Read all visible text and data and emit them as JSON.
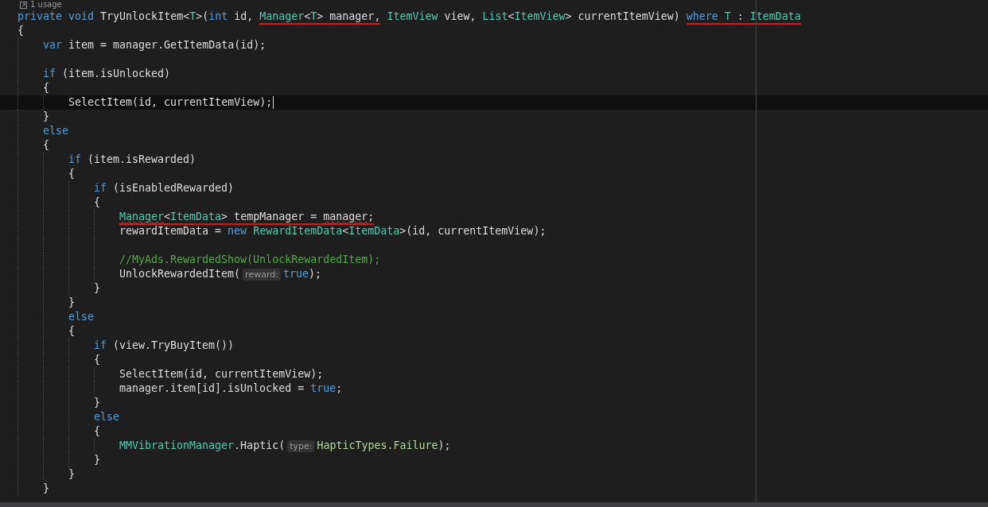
{
  "codelens": {
    "text": "1 usage"
  },
  "lines": [
    {
      "kind": "line",
      "current": false,
      "tokens": [
        {
          "kind": "keyword",
          "text": "private void "
        },
        {
          "kind": "plain",
          "text": "TryUnlockItem<"
        },
        {
          "kind": "type",
          "text": "T"
        },
        {
          "kind": "plain",
          "text": ">("
        },
        {
          "kind": "keyword",
          "text": "int"
        },
        {
          "kind": "plain",
          "text": " id, "
        },
        {
          "kind": "type",
          "text": "Manager",
          "underlined": true
        },
        {
          "kind": "plain",
          "text": "<",
          "underlined": true
        },
        {
          "kind": "type",
          "text": "T",
          "underlined": true
        },
        {
          "kind": "plain",
          "text": "> manager,",
          "underlined": true
        },
        {
          "kind": "type",
          "text": " ItemView"
        },
        {
          "kind": "plain",
          "text": " view, "
        },
        {
          "kind": "type",
          "text": "List"
        },
        {
          "kind": "plain",
          "text": "<"
        },
        {
          "kind": "type",
          "text": "ItemView"
        },
        {
          "kind": "plain",
          "text": "> currentItemView) "
        },
        {
          "kind": "keyword",
          "text": "where ",
          "underlined": true
        },
        {
          "kind": "type",
          "text": "T",
          "underlined": true
        },
        {
          "kind": "plain",
          "text": " : ",
          "underlined": true
        },
        {
          "kind": "type",
          "text": "ItemData",
          "underlined": true
        }
      ]
    },
    {
      "kind": "line",
      "current": false,
      "tokens": [
        {
          "kind": "plain",
          "text": "{"
        }
      ]
    },
    {
      "kind": "block",
      "children": [
        {
          "kind": "line",
          "current": false,
          "tokens": [
            {
              "kind": "keyword",
              "text": "var"
            },
            {
              "kind": "plain",
              "text": " item = manager.GetItemData(id);"
            }
          ]
        },
        {
          "kind": "line",
          "current": false
        },
        {
          "kind": "line",
          "current": false,
          "tokens": [
            {
              "kind": "keyword",
              "text": "if"
            },
            {
              "kind": "plain",
              "text": " (item.isUnlocked)"
            }
          ]
        },
        {
          "kind": "line",
          "current": false,
          "tokens": [
            {
              "kind": "plain",
              "text": "{"
            }
          ]
        },
        {
          "kind": "block",
          "children": [
            {
              "kind": "line",
              "current": true,
              "tokens": [
                {
                  "kind": "plain",
                  "text": "SelectItem(id, currentItemView);"
                }
              ]
            }
          ]
        },
        {
          "kind": "line",
          "current": false,
          "tokens": [
            {
              "kind": "plain",
              "text": "}"
            }
          ]
        },
        {
          "kind": "line",
          "current": false,
          "tokens": [
            {
              "kind": "keyword",
              "text": "else"
            }
          ]
        },
        {
          "kind": "line",
          "current": false,
          "tokens": [
            {
              "kind": "plain",
              "text": "{"
            }
          ]
        },
        {
          "kind": "block",
          "children": [
            {
              "kind": "line",
              "current": false,
              "tokens": [
                {
                  "kind": "keyword",
                  "text": "if"
                },
                {
                  "kind": "plain",
                  "text": " (item.isRewarded)"
                }
              ]
            },
            {
              "kind": "line",
              "current": false,
              "tokens": [
                {
                  "kind": "plain",
                  "text": "{"
                }
              ]
            },
            {
              "kind": "block",
              "children": [
                {
                  "kind": "line",
                  "current": false,
                  "tokens": [
                    {
                      "kind": "keyword",
                      "text": "if"
                    },
                    {
                      "kind": "plain",
                      "text": " (isEnabledRewarded)"
                    }
                  ]
                },
                {
                  "kind": "line",
                  "current": false,
                  "tokens": [
                    {
                      "kind": "plain",
                      "text": "{"
                    }
                  ]
                },
                {
                  "kind": "block",
                  "children": [
                    {
                      "kind": "line",
                      "current": false,
                      "tokens": [
                        {
                          "kind": "type",
                          "text": "Manager",
                          "underlined": true,
                          "squiggle": true
                        },
                        {
                          "kind": "plain",
                          "text": "<",
                          "underlined": true
                        },
                        {
                          "kind": "type",
                          "text": "ItemData",
                          "underlined": true
                        },
                        {
                          "kind": "plain",
                          "text": "> tempManager = ",
                          "underlined": true
                        },
                        {
                          "kind": "plain",
                          "text": "manager",
                          "underlined": true,
                          "squiggle": true
                        },
                        {
                          "kind": "plain",
                          "text": ";",
                          "underlined": true
                        }
                      ]
                    },
                    {
                      "kind": "line",
                      "current": false,
                      "tokens": [
                        {
                          "kind": "plain",
                          "text": "rewardItemData = "
                        },
                        {
                          "kind": "keyword",
                          "text": "new "
                        },
                        {
                          "kind": "type",
                          "text": "RewardItemData"
                        },
                        {
                          "kind": "plain",
                          "text": "<"
                        },
                        {
                          "kind": "type",
                          "text": "ItemData"
                        },
                        {
                          "kind": "plain",
                          "text": ">(id, currentItemView);"
                        }
                      ]
                    },
                    {
                      "kind": "line",
                      "current": false
                    },
                    {
                      "kind": "line",
                      "current": false,
                      "tokens": [
                        {
                          "kind": "comment",
                          "text": "//MyAds.RewardedShow(UnlockRewardedItem);"
                        }
                      ]
                    },
                    {
                      "kind": "line",
                      "current": false,
                      "tokens": [
                        {
                          "kind": "plain",
                          "text": "UnlockRewardedItem("
                        },
                        {
                          "kind": "hint",
                          "text": "reward:"
                        },
                        {
                          "kind": "keyword",
                          "text": "true"
                        },
                        {
                          "kind": "plain",
                          "text": ");"
                        }
                      ]
                    }
                  ]
                },
                {
                  "kind": "line",
                  "current": false,
                  "tokens": [
                    {
                      "kind": "plain",
                      "text": "}"
                    }
                  ]
                }
              ]
            },
            {
              "kind": "line",
              "current": false,
              "tokens": [
                {
                  "kind": "plain",
                  "text": "}"
                }
              ]
            },
            {
              "kind": "line",
              "current": false,
              "tokens": [
                {
                  "kind": "keyword",
                  "text": "else"
                }
              ]
            },
            {
              "kind": "line",
              "current": false,
              "tokens": [
                {
                  "kind": "plain",
                  "text": "{"
                }
              ]
            },
            {
              "kind": "block",
              "children": [
                {
                  "kind": "line",
                  "current": false,
                  "tokens": [
                    {
                      "kind": "keyword",
                      "text": "if"
                    },
                    {
                      "kind": "plain",
                      "text": " (view.TryBuyItem())"
                    }
                  ]
                },
                {
                  "kind": "line",
                  "current": false,
                  "tokens": [
                    {
                      "kind": "plain",
                      "text": "{"
                    }
                  ]
                },
                {
                  "kind": "block",
                  "children": [
                    {
                      "kind": "line",
                      "current": false,
                      "tokens": [
                        {
                          "kind": "plain",
                          "text": "SelectItem(id, currentItemView);"
                        }
                      ]
                    },
                    {
                      "kind": "line",
                      "current": false,
                      "tokens": [
                        {
                          "kind": "plain",
                          "text": "manager.item[id].isUnlocked = "
                        },
                        {
                          "kind": "keyword",
                          "text": "true"
                        },
                        {
                          "kind": "plain",
                          "text": ";"
                        }
                      ]
                    }
                  ]
                },
                {
                  "kind": "line",
                  "current": false,
                  "tokens": [
                    {
                      "kind": "plain",
                      "text": "}"
                    }
                  ]
                },
                {
                  "kind": "line",
                  "current": false,
                  "tokens": [
                    {
                      "kind": "keyword",
                      "text": "else"
                    }
                  ]
                },
                {
                  "kind": "line",
                  "current": false,
                  "tokens": [
                    {
                      "kind": "plain",
                      "text": "{"
                    }
                  ]
                },
                {
                  "kind": "block",
                  "children": [
                    {
                      "kind": "line",
                      "current": false,
                      "tokens": [
                        {
                          "kind": "type",
                          "text": "MMVibrationManager"
                        },
                        {
                          "kind": "plain",
                          "text": ".Haptic("
                        },
                        {
                          "kind": "hint",
                          "text": "type:"
                        },
                        {
                          "kind": "enum",
                          "text": "HapticTypes.Failure"
                        },
                        {
                          "kind": "plain",
                          "text": ");"
                        }
                      ]
                    }
                  ]
                },
                {
                  "kind": "line",
                  "current": false,
                  "tokens": [
                    {
                      "kind": "plain",
                      "text": "}"
                    }
                  ]
                }
              ]
            },
            {
              "kind": "line",
              "current": false,
              "tokens": [
                {
                  "kind": "plain",
                  "text": "}"
                }
              ]
            }
          ]
        },
        {
          "kind": "line",
          "current": false,
          "tokens": [
            {
              "kind": "plain",
              "text": "}"
            }
          ]
        }
      ]
    }
  ]
}
